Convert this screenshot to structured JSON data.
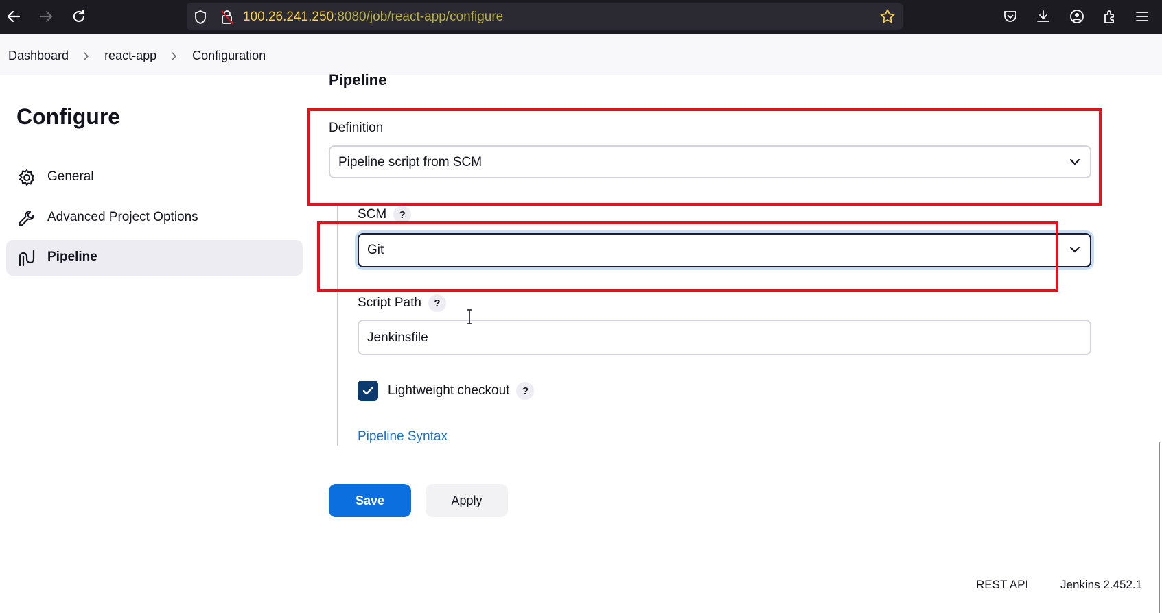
{
  "browser": {
    "url_host": "100.26.241.250",
    "url_rest": ":8080/job/react-app/configure"
  },
  "breadcrumb": [
    "Dashboard",
    "react-app",
    "Configuration"
  ],
  "sidebar": {
    "title": "Configure",
    "items": [
      {
        "label": "General",
        "icon": "gear-icon"
      },
      {
        "label": "Advanced Project Options",
        "icon": "wrench-icon"
      },
      {
        "label": "Pipeline",
        "icon": "pipeline-icon",
        "active": true
      }
    ]
  },
  "main": {
    "section_title": "Pipeline",
    "definition": {
      "label": "Definition",
      "value": "Pipeline script from SCM"
    },
    "scm": {
      "label": "SCM",
      "value": "Git"
    },
    "script_path": {
      "label": "Script Path",
      "value": "Jenkinsfile"
    },
    "lightweight_checkout": {
      "label": "Lightweight checkout",
      "checked": true
    },
    "help_glyph": "?",
    "syntax_link": "Pipeline Syntax",
    "save_label": "Save",
    "apply_label": "Apply"
  },
  "footer": {
    "rest_api": "REST API",
    "version": "Jenkins 2.452.1"
  },
  "colors": {
    "primary": "#0b6fe0",
    "annotation": "#e0141e",
    "checkbox": "#0b3a6e",
    "link": "#1f6fc5"
  }
}
